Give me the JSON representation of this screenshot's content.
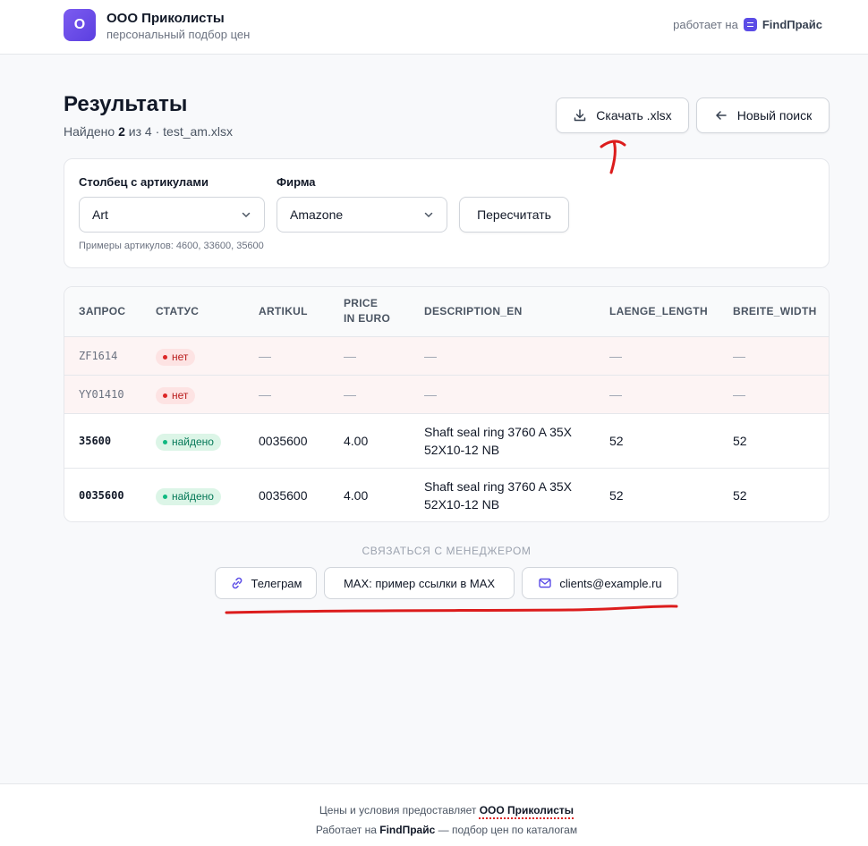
{
  "header": {
    "logo_letter": "О",
    "company": "ООО Приколисты",
    "subtitle": "персональный подбор цен",
    "powered_prefix": "работает на",
    "powered_brand": "FindПрайс"
  },
  "results": {
    "title": "Результаты",
    "found_prefix": "Найдено",
    "found_count": "2",
    "found_suffix": "из 4 · test_am.xlsx",
    "download_label": "Скачать .xlsx",
    "new_search_label": "Новый поиск"
  },
  "filters": {
    "column_label": "Столбец с артикулами",
    "column_value": "Art",
    "firm_label": "Фирма",
    "firm_value": "Amazone",
    "recalc_label": "Пересчитать",
    "examples": "Примеры артикулов: 4600, 33600, 35600"
  },
  "table": {
    "columns": [
      "ЗАПРОС",
      "СТАТУС",
      "ARTIKUL",
      "PRICE IN EURO",
      "DESCRIPTION_EN",
      "LAENGE_LENGTH",
      "BREITE_WIDTH"
    ],
    "rows": [
      {
        "query": "ZF1614",
        "status": "нет",
        "artikul": "—",
        "price": "—",
        "description": "—",
        "length": "—",
        "width": "—"
      },
      {
        "query": "YY01410",
        "status": "нет",
        "artikul": "—",
        "price": "—",
        "description": "—",
        "length": "—",
        "width": "—"
      },
      {
        "query": "35600",
        "status": "найдено",
        "artikul": "0035600",
        "price": "4.00",
        "description": "Shaft seal ring 3760 A 35X 52X10-12 NB",
        "length": "52",
        "width": "52"
      },
      {
        "query": "0035600",
        "status": "найдено",
        "artikul": "0035600",
        "price": "4.00",
        "description": "Shaft seal ring 3760 A 35X 52X10-12 NB",
        "length": "52",
        "width": "52"
      }
    ]
  },
  "contact": {
    "title": "СВЯЗАТЬСЯ С МЕНЕДЖЕРОМ",
    "telegram": "Телеграм",
    "max": "MAX: пример ссылки в MAX",
    "email": "clients@example.ru"
  },
  "footer": {
    "line1_prefix": "Цены и условия предоставляет",
    "line1_company": "ООО Приколисты",
    "line2_prefix": "Работает на",
    "line2_brand": "FindПрайс",
    "line2_suffix": "— подбор цен по каталогам"
  },
  "colors": {
    "accent": "#5b4ce6",
    "miss_row_bg": "#fdf4f4",
    "annotation_red": "#dc1c1c"
  }
}
